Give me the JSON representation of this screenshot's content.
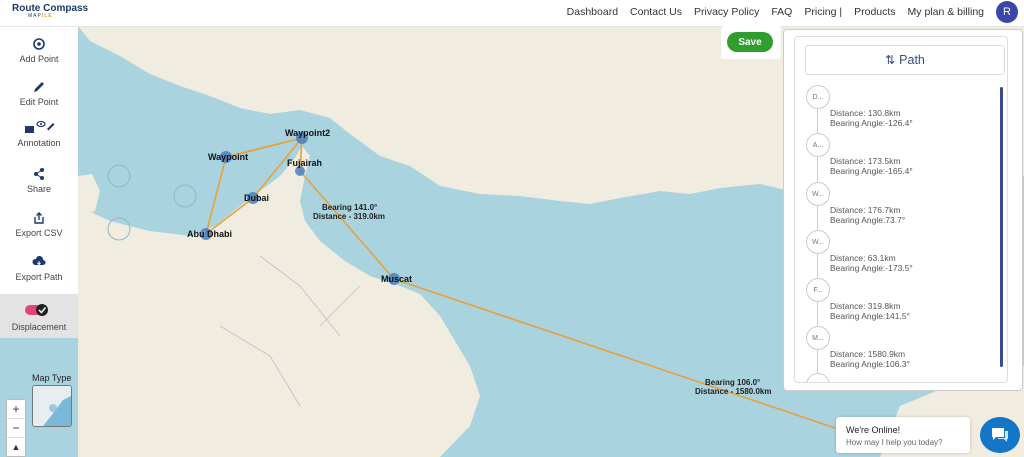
{
  "header": {
    "logo_line1": "Route Compass",
    "logo_line2a": "MAP",
    "logo_line2b": "ILE",
    "nav": [
      "Dashboard",
      "Contact Us",
      "Privacy Policy",
      "FAQ",
      "Pricing |",
      "Products",
      "My plan & billing"
    ],
    "avatar": "R"
  },
  "sidebar": {
    "items": [
      {
        "label": "Add Point",
        "icon": "add-point-icon"
      },
      {
        "label": "Edit Point",
        "icon": "pencil-icon"
      },
      {
        "label": "Annotation",
        "icon": "annotation-icon"
      },
      {
        "label": "Share",
        "icon": "share-icon"
      },
      {
        "label": "Export CSV",
        "icon": "export-icon"
      },
      {
        "label": "Export Path",
        "icon": "cloud-download-icon"
      },
      {
        "label": "Displacement",
        "icon": "toggle-icon"
      }
    ]
  },
  "map": {
    "labels": [
      "Waypoint",
      "Waypoint2",
      "Fujairah",
      "Dubai",
      "Abu Dhabi",
      "Muscat"
    ],
    "annotations": [
      {
        "bearing": "Bearing  141.0°",
        "distance": "Distance - 319.0km"
      },
      {
        "bearing": "Bearing  106.0°",
        "distance": "Distance - 1580.0km"
      }
    ],
    "map_type_label": "Map Type",
    "zoom_in": "+",
    "zoom_out": "−"
  },
  "save_label": "Save",
  "path_panel": {
    "title": "Path",
    "nodes": [
      {
        "abbr": "D...",
        "distance": "",
        "bearing": ""
      },
      {
        "abbr": "A...",
        "distance": "Distance: 130.8km",
        "bearing": "Bearing Angle:-126.4°"
      },
      {
        "abbr": "W...",
        "distance": "Distance: 173.5km",
        "bearing": "Bearing Angle:-165.4°"
      },
      {
        "abbr": "W...",
        "distance": "Distance: 176.7km",
        "bearing": "Bearing Angle:73.7°"
      },
      {
        "abbr": "F...",
        "distance": "Distance: 63.1km",
        "bearing": "Bearing Angle:-173.5°"
      },
      {
        "abbr": "M...",
        "distance": "Distance: 319.8km",
        "bearing": "Bearing Angle:141.5°"
      }
    ],
    "last_distance": "Distance: 1580.9km",
    "last_bearing": "Bearing Angle:106.3°"
  },
  "chat": {
    "title": "We're Online!",
    "subtitle": "How may I help you today?"
  },
  "colors": {
    "sea": "#a9d3df",
    "land": "#f1ece0",
    "route": "#e8a13a",
    "save": "#2f9e2f",
    "accent": "#3b4a8a"
  }
}
